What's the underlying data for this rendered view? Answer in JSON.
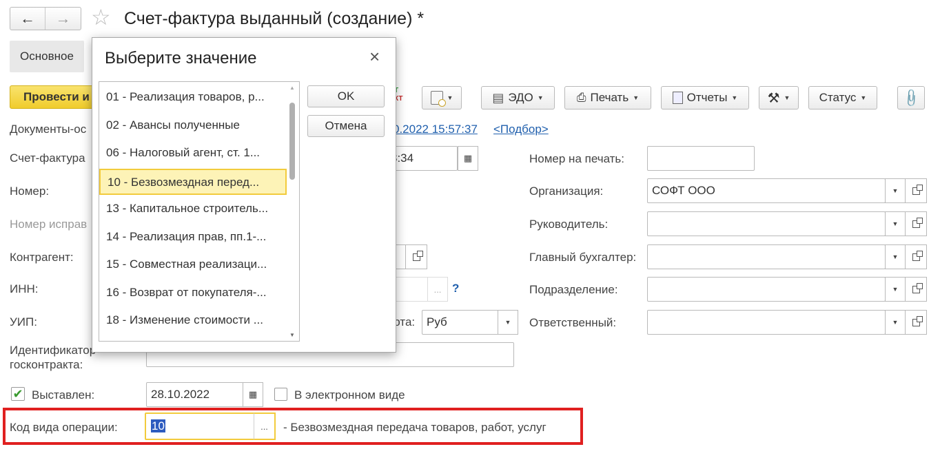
{
  "window": {
    "title": "Счет-фактура выданный (создание) *"
  },
  "tabs": {
    "main": "Основное"
  },
  "toolbar": {
    "post": "Провести и",
    "edo": "ЭДО",
    "print": "Печать",
    "reports": "Отчеты",
    "status": "Статус"
  },
  "form": {
    "docs_label": "Документы-ос",
    "docs_date": "0.2022 15:57:37",
    "pick_link": "<Подбор>",
    "invoice_label": "Счет-фактура",
    "invoice_time": "8:34",
    "number_label": "Номер:",
    "correction_label": "Номер исправ",
    "counterparty_label": "Контрагент:",
    "inn_label": "ИНН:",
    "help_mark": "?",
    "uip_label": "УИП:",
    "currency_label": "юта:",
    "currency_value": "Руб",
    "contract_label": "Идентификатор госконтракта:",
    "issued_label": "Выставлен:",
    "issued_checked": true,
    "issued_date": "28.10.2022",
    "electronic_label": "В электронном виде",
    "opcode_label": "Код вида операции:",
    "opcode_value": "10",
    "opcode_desc": "- Безвозмездная передача товаров, работ, услуг",
    "print_number_label": "Номер на печать:",
    "org_label": "Организация:",
    "org_value": "СОФТ ООО",
    "head_label": "Руководитель:",
    "chief_acc_label": "Главный бухгалтер:",
    "dept_label": "Подразделение:",
    "responsible_label": "Ответственный:",
    "highlight_color": "#e02020"
  },
  "dialog": {
    "title": "Выберите значение",
    "ok": "OK",
    "cancel": "Отмена",
    "items": [
      "01 - Реализация товаров, р...",
      "02 - Авансы полученные",
      "06 - Налоговый агент, ст. 1...",
      "10 - Безвозмездная перед...",
      "13 - Капитальное строитель...",
      "14 - Реализация прав, пп.1-...",
      "15 - Совместная реализаци...",
      "16 - Возврат от покупателя-...",
      "18 - Изменение стоимости ..."
    ],
    "selected_index": 3
  },
  "colors": {
    "post_button": "#f5d94a",
    "selection_bg": "#fdf3b7",
    "selection_border": "#f2cb3c",
    "link": "#1f5fad"
  }
}
